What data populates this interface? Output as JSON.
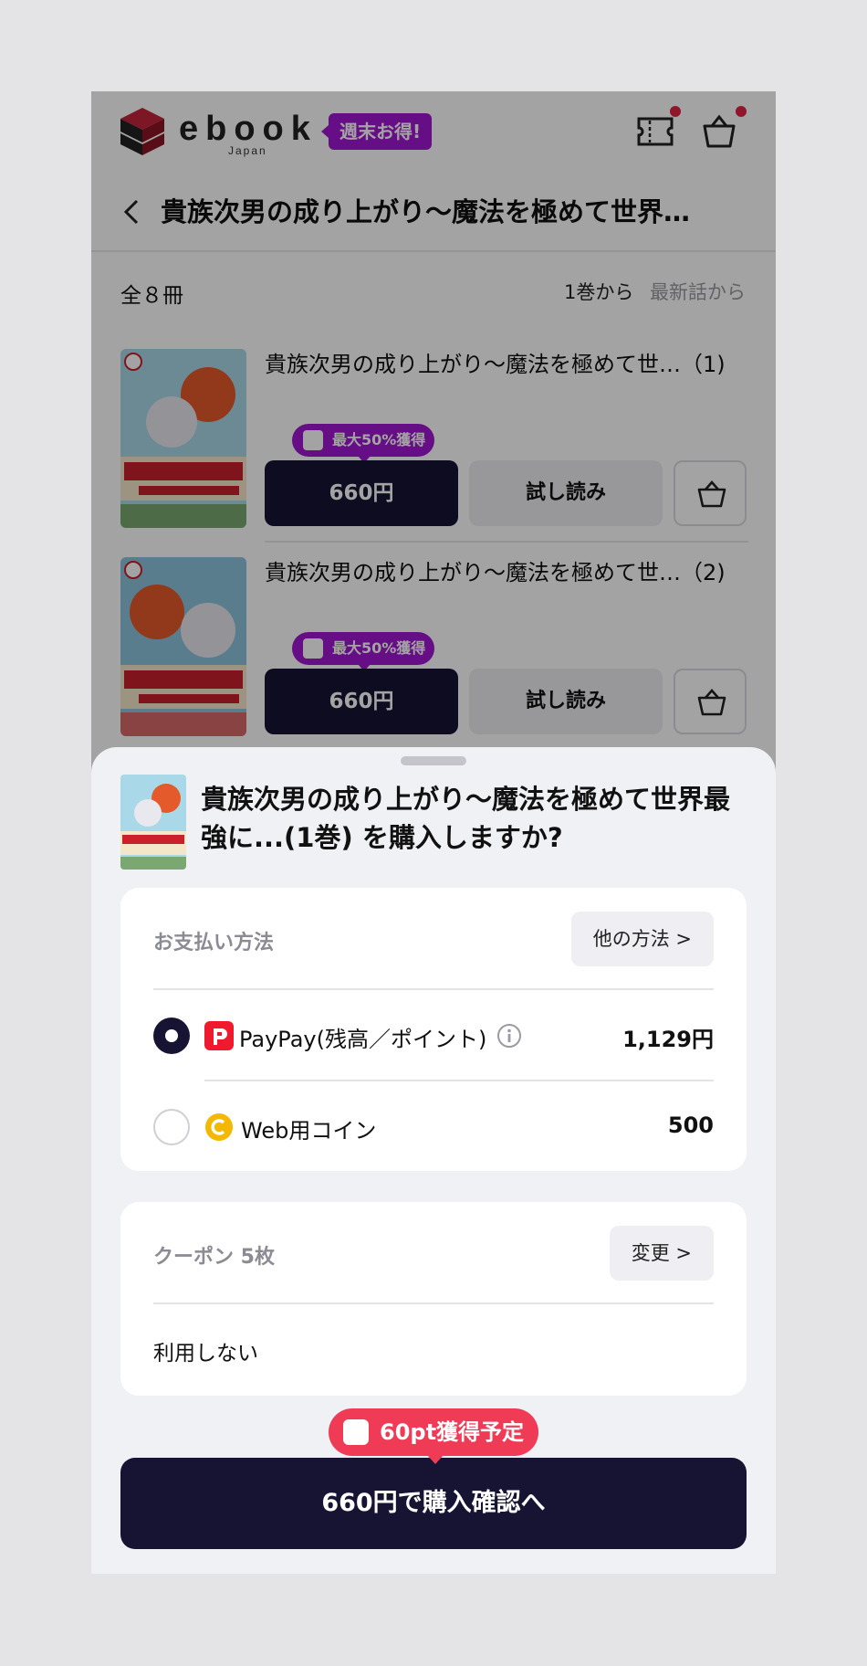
{
  "header": {
    "logo_text": "ebook",
    "logo_sub": "Japan",
    "promo": "週末お得!"
  },
  "title_bar": {
    "title": "貴族次男の成り上がり〜魔法を極めて世界…"
  },
  "list_header": {
    "count": "全８冊",
    "sort_first": "1巻から",
    "sort_latest": "最新話から"
  },
  "volumes": [
    {
      "title": "貴族次男の成り上がり〜魔法を極めて世…（1)",
      "badge": "最大50%獲得",
      "price": "660円",
      "trial": "試し読み"
    },
    {
      "title": "貴族次男の成り上がり〜魔法を極めて世…（2)",
      "badge": "最大50%獲得",
      "price": "660円",
      "trial": "試し読み"
    }
  ],
  "sheet": {
    "title": "貴族次男の成り上がり〜魔法を極めて世界最強に...(1巻) を購入しますか?",
    "payment": {
      "label": "お支払い方法",
      "other_button": "他の方法 >",
      "options": [
        {
          "label": "PayPay(残高／ポイント)",
          "value": "1,129円",
          "selected": true,
          "icon": "paypay-icon"
        },
        {
          "label": "Web用コイン",
          "value": "500",
          "selected": false,
          "icon": "coin-icon"
        }
      ]
    },
    "coupon": {
      "label": "クーポン 5枚",
      "change_button": "変更 >",
      "value": "利用しない"
    },
    "points_badge": "60pt獲得予定",
    "cta": "660円で購入確認へ"
  },
  "colors": {
    "navy": "#171433",
    "purple": "#a016d0",
    "paypay_red": "#ef3b56",
    "coin_yellow": "#f5b800"
  }
}
